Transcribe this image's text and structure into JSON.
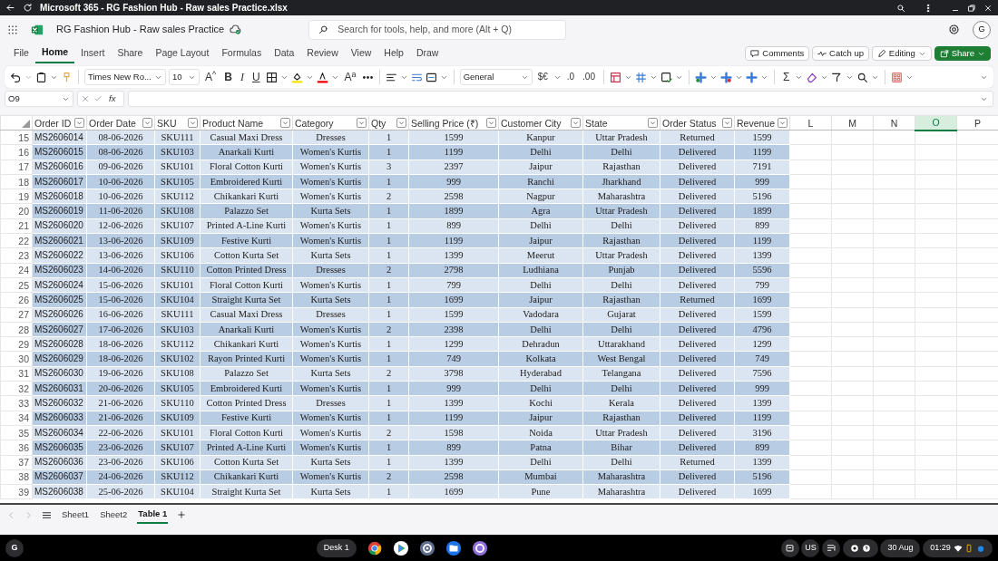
{
  "window": {
    "title": "Microsoft 365 - RG Fashion Hub - Raw sales Practice.xlsx"
  },
  "app": {
    "document_name": "RG Fashion Hub - Raw sales Practice",
    "search": {
      "placeholder": "Search for tools, help, and more (Alt + Q)"
    },
    "avatar": "G"
  },
  "ribbon_tabs": [
    {
      "label": "File",
      "selected": false
    },
    {
      "label": "Home",
      "selected": true
    },
    {
      "label": "Insert",
      "selected": false
    },
    {
      "label": "Share",
      "selected": false
    },
    {
      "label": "Page Layout",
      "selected": false
    },
    {
      "label": "Formulas",
      "selected": false
    },
    {
      "label": "Data",
      "selected": false
    },
    {
      "label": "Review",
      "selected": false
    },
    {
      "label": "View",
      "selected": false
    },
    {
      "label": "Help",
      "selected": false
    },
    {
      "label": "Draw",
      "selected": false
    }
  ],
  "header_buttons": [
    {
      "kind": "comments",
      "label": "Comments"
    },
    {
      "kind": "catchup",
      "label": "Catch up"
    },
    {
      "kind": "editing",
      "label": "Editing"
    },
    {
      "kind": "share",
      "label": "Share"
    }
  ],
  "toolbar": {
    "font": "Times New Ro...",
    "size": "10",
    "number_format": "General",
    "glyphs": [
      {
        "kind": "grow",
        "text": "A$^{^}$"
      },
      {
        "kind": "bold",
        "text": "B"
      },
      {
        "kind": "italic",
        "text": "I"
      },
      {
        "kind": "underline",
        "text": "U"
      },
      {
        "kind": "effects",
        "text": "A$^{a}$"
      },
      {
        "kind": "currency",
        "text": "$€"
      },
      {
        "kind": "decimal",
        "text": ".0"
      },
      {
        "kind": "decimal",
        "text": ".00"
      },
      {
        "kind": "sum",
        "text": "Σ"
      }
    ]
  },
  "formula_bar": {
    "name_box": "O9",
    "fx": "fx"
  },
  "columns": [
    {
      "label": "Order ID",
      "filter": true,
      "selected": false
    },
    {
      "label": "Order Date",
      "filter": true,
      "selected": false
    },
    {
      "label": "SKU",
      "filter": true,
      "selected": false
    },
    {
      "label": "Product Name",
      "filter": true,
      "selected": false
    },
    {
      "label": "Category",
      "filter": true,
      "selected": false
    },
    {
      "label": "Qty",
      "filter": true,
      "selected": false
    },
    {
      "label": "Selling Price (₹)",
      "filter": true,
      "selected": false
    },
    {
      "label": "Customer City",
      "filter": true,
      "selected": false
    },
    {
      "label": "State",
      "filter": true,
      "selected": false
    },
    {
      "label": "Order Status",
      "filter": true,
      "selected": false
    },
    {
      "label": "Revenue",
      "filter": true,
      "selected": false
    },
    {
      "label": "L",
      "filter": false,
      "selected": false
    },
    {
      "label": "M",
      "filter": false,
      "selected": false
    },
    {
      "label": "N",
      "filter": false,
      "selected": false
    },
    {
      "label": "O",
      "filter": false,
      "selected": true
    },
    {
      "label": "P",
      "filter": false,
      "selected": false
    }
  ],
  "rows": [
    {
      "number": "15",
      "banded": false,
      "cells": [
        "MS2606014",
        "08-06-2026",
        "SKU111",
        "Casual Maxi Dress",
        "Dresses",
        "1",
        "1599",
        "Kanpur",
        "Uttar Pradesh",
        "Returned",
        "1599"
      ]
    },
    {
      "number": "16",
      "banded": true,
      "cells": [
        "MS2606015",
        "08-06-2026",
        "SKU103",
        "Anarkali Kurti",
        "Women's Kurtis",
        "1",
        "1199",
        "Delhi",
        "Delhi",
        "Delivered",
        "1199"
      ]
    },
    {
      "number": "17",
      "banded": false,
      "cells": [
        "MS2606016",
        "09-06-2026",
        "SKU101",
        "Floral Cotton Kurti",
        "Women's Kurtis",
        "3",
        "2397",
        "Jaipur",
        "Rajasthan",
        "Delivered",
        "7191"
      ]
    },
    {
      "number": "18",
      "banded": true,
      "cells": [
        "MS2606017",
        "10-06-2026",
        "SKU105",
        "Embroidered Kurti",
        "Women's Kurtis",
        "1",
        "999",
        "Ranchi",
        "Jharkhand",
        "Delivered",
        "999"
      ]
    },
    {
      "number": "19",
      "banded": false,
      "cells": [
        "MS2606018",
        "10-06-2026",
        "SKU112",
        "Chikankari Kurti",
        "Women's Kurtis",
        "2",
        "2598",
        "Nagpur",
        "Maharashtra",
        "Delivered",
        "5196"
      ]
    },
    {
      "number": "20",
      "banded": true,
      "cells": [
        "MS2606019",
        "11-06-2026",
        "SKU108",
        "Palazzo Set",
        "Kurta Sets",
        "1",
        "1899",
        "Agra",
        "Uttar Pradesh",
        "Delivered",
        "1899"
      ]
    },
    {
      "number": "21",
      "banded": false,
      "cells": [
        "MS2606020",
        "12-06-2026",
        "SKU107",
        "Printed A-Line Kurti",
        "Women's Kurtis",
        "1",
        "899",
        "Delhi",
        "Delhi",
        "Delivered",
        "899"
      ]
    },
    {
      "number": "22",
      "banded": true,
      "cells": [
        "MS2606021",
        "13-06-2026",
        "SKU109",
        "Festive Kurti",
        "Women's Kurtis",
        "1",
        "1199",
        "Jaipur",
        "Rajasthan",
        "Delivered",
        "1199"
      ]
    },
    {
      "number": "23",
      "banded": false,
      "cells": [
        "MS2606022",
        "13-06-2026",
        "SKU106",
        "Cotton Kurta Set",
        "Kurta Sets",
        "1",
        "1399",
        "Meerut",
        "Uttar Pradesh",
        "Delivered",
        "1399"
      ]
    },
    {
      "number": "24",
      "banded": true,
      "cells": [
        "MS2606023",
        "14-06-2026",
        "SKU110",
        "Cotton Printed Dress",
        "Dresses",
        "2",
        "2798",
        "Ludhiana",
        "Punjab",
        "Delivered",
        "5596"
      ]
    },
    {
      "number": "25",
      "banded": false,
      "cells": [
        "MS2606024",
        "15-06-2026",
        "SKU101",
        "Floral Cotton Kurti",
        "Women's Kurtis",
        "1",
        "799",
        "Delhi",
        "Delhi",
        "Delivered",
        "799"
      ]
    },
    {
      "number": "26",
      "banded": true,
      "cells": [
        "MS2606025",
        "15-06-2026",
        "SKU104",
        "Straight Kurta Set",
        "Kurta Sets",
        "1",
        "1699",
        "Jaipur",
        "Rajasthan",
        "Returned",
        "1699"
      ]
    },
    {
      "number": "27",
      "banded": false,
      "cells": [
        "MS2606026",
        "16-06-2026",
        "SKU111",
        "Casual Maxi Dress",
        "Dresses",
        "1",
        "1599",
        "Vadodara",
        "Gujarat",
        "Delivered",
        "1599"
      ]
    },
    {
      "number": "28",
      "banded": true,
      "cells": [
        "MS2606027",
        "17-06-2026",
        "SKU103",
        "Anarkali Kurti",
        "Women's Kurtis",
        "2",
        "2398",
        "Delhi",
        "Delhi",
        "Delivered",
        "4796"
      ]
    },
    {
      "number": "29",
      "banded": false,
      "cells": [
        "MS2606028",
        "18-06-2026",
        "SKU112",
        "Chikankari Kurti",
        "Women's Kurtis",
        "1",
        "1299",
        "Dehradun",
        "Uttarakhand",
        "Delivered",
        "1299"
      ]
    },
    {
      "number": "30",
      "banded": true,
      "cells": [
        "MS2606029",
        "18-06-2026",
        "SKU102",
        "Rayon Printed Kurti",
        "Women's Kurtis",
        "1",
        "749",
        "Kolkata",
        "West Bengal",
        "Delivered",
        "749"
      ]
    },
    {
      "number": "31",
      "banded": false,
      "cells": [
        "MS2606030",
        "19-06-2026",
        "SKU108",
        "Palazzo Set",
        "Kurta Sets",
        "2",
        "3798",
        "Hyderabad",
        "Telangana",
        "Delivered",
        "7596"
      ]
    },
    {
      "number": "32",
      "banded": true,
      "cells": [
        "MS2606031",
        "20-06-2026",
        "SKU105",
        "Embroidered Kurti",
        "Women's Kurtis",
        "1",
        "999",
        "Delhi",
        "Delhi",
        "Delivered",
        "999"
      ]
    },
    {
      "number": "33",
      "banded": false,
      "cells": [
        "MS2606032",
        "21-06-2026",
        "SKU110",
        "Cotton Printed Dress",
        "Dresses",
        "1",
        "1399",
        "Kochi",
        "Kerala",
        "Delivered",
        "1399"
      ]
    },
    {
      "number": "34",
      "banded": true,
      "cells": [
        "MS2606033",
        "21-06-2026",
        "SKU109",
        "Festive Kurti",
        "Women's Kurtis",
        "1",
        "1199",
        "Jaipur",
        "Rajasthan",
        "Delivered",
        "1199"
      ]
    },
    {
      "number": "35",
      "banded": false,
      "cells": [
        "MS2606034",
        "22-06-2026",
        "SKU101",
        "Floral Cotton Kurti",
        "Women's Kurtis",
        "2",
        "1598",
        "Noida",
        "Uttar Pradesh",
        "Delivered",
        "3196"
      ]
    },
    {
      "number": "36",
      "banded": true,
      "cells": [
        "MS2606035",
        "23-06-2026",
        "SKU107",
        "Printed A-Line Kurti",
        "Women's Kurtis",
        "1",
        "899",
        "Patna",
        "Bihar",
        "Delivered",
        "899"
      ]
    },
    {
      "number": "37",
      "banded": false,
      "cells": [
        "MS2606036",
        "23-06-2026",
        "SKU106",
        "Cotton Kurta Set",
        "Kurta Sets",
        "1",
        "1399",
        "Delhi",
        "Delhi",
        "Returned",
        "1399"
      ]
    },
    {
      "number": "38",
      "banded": true,
      "cells": [
        "MS2606037",
        "24-06-2026",
        "SKU112",
        "Chikankari Kurti",
        "Women's Kurtis",
        "2",
        "2598",
        "Mumbai",
        "Maharashtra",
        "Delivered",
        "5196"
      ]
    },
    {
      "number": "39",
      "banded": false,
      "cells": [
        "MS2606038",
        "25-06-2026",
        "SKU104",
        "Straight Kurta Set",
        "Kurta Sets",
        "1",
        "1699",
        "Pune",
        "Maharashtra",
        "Delivered",
        "1699"
      ]
    }
  ],
  "sheet_tabs": [
    {
      "label": "Sheet1",
      "selected": false
    },
    {
      "label": "Sheet2",
      "selected": false
    },
    {
      "label": "Table 1",
      "selected": true
    }
  ],
  "taskbar": {
    "launcher": "G",
    "desk": "Desk 1",
    "input_method": "US",
    "date": "30 Aug",
    "time": "01:29"
  }
}
